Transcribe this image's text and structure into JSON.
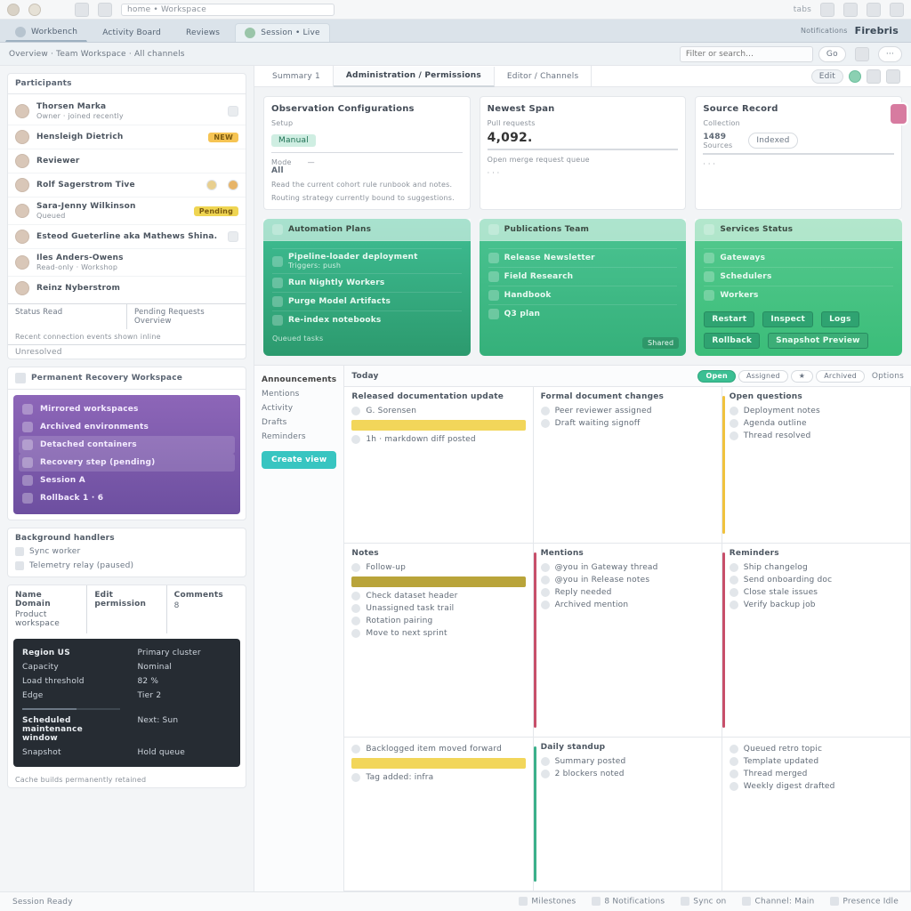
{
  "chrome": {
    "address": "home  •  Workspace",
    "label": "tabs"
  },
  "tabs": {
    "items": [
      {
        "label": "Workbench"
      },
      {
        "label": "Activity Board"
      },
      {
        "label": "Reviews"
      },
      {
        "label": "Session • Live"
      }
    ],
    "right_label": "Notifications",
    "brand": "Firebris"
  },
  "subbar": {
    "crumb": "Overview  ·  Team Workspace  ·  All channels",
    "search_placeholder": "Filter or search…",
    "search_action": "Go",
    "more": "···"
  },
  "mtabs": {
    "items": [
      "Summary 1",
      "Administration / Permissions",
      "Editor / Channels"
    ],
    "pill": "Edit"
  },
  "cards": [
    {
      "title": "Observation Configurations",
      "sub": "Setup",
      "chip": "Manual",
      "a_k": "Mode",
      "a_v": "All",
      "note": "Read the current cohort rule runbook and notes.",
      "hint": "Routing strategy currently bound to suggestions."
    },
    {
      "title": "Newest Span",
      "sub": "Pull requests",
      "big": "4,092.",
      "foot": "Open merge request queue"
    },
    {
      "title": "Source Record",
      "sub": "Collection",
      "a": "1489",
      "b": "Sources",
      "badge": "Indexed"
    }
  ],
  "greens": [
    {
      "head": "Automation Plans",
      "lines": [
        {
          "t": "Pipeline-loader deployment",
          "s": "Triggers: push"
        },
        {
          "t": "Run Nightly Workers",
          "s": ""
        },
        {
          "t": "Purge  Model Artifacts",
          "s": ""
        },
        {
          "t": "Re-index notebooks",
          "s": ""
        }
      ],
      "foot": "Queued tasks"
    },
    {
      "head": "Publications  Team",
      "lines": [
        {
          "t": "Release Newsletter",
          "s": ""
        },
        {
          "t": "Field Research",
          "s": ""
        },
        {
          "t": "Handbook",
          "s": ""
        },
        {
          "t": "Q3 plan",
          "s": ""
        }
      ],
      "tag": "Shared"
    },
    {
      "head": "Services  Status",
      "lines": [
        {
          "t": "Gateways",
          "s": ""
        },
        {
          "t": "Schedulers",
          "s": ""
        },
        {
          "t": "Workers",
          "s": ""
        }
      ],
      "btns": [
        "Restart",
        "Inspect",
        "Logs"
      ],
      "btn2": [
        "Rollback",
        "Snapshot  Preview"
      ]
    }
  ],
  "people": {
    "head": "Participants",
    "rows": [
      {
        "n": "Thorsen Marka",
        "s": "Owner · joined recently",
        "badge": ""
      },
      {
        "n": "Hensleigh Dietrich",
        "s": "",
        "badge": "NEW"
      },
      {
        "n": "Reviewer",
        "s": "",
        "badge": ""
      },
      {
        "n": "Rolf Sagerstrom Tive",
        "s": "",
        "badge": ""
      },
      {
        "n": "Sara-Jenny Wilkinson",
        "s": "Queued",
        "badge": "Pending"
      },
      {
        "n": "Esteod Gueterline aka Mathews Shina.",
        "s": "",
        "badge": ""
      },
      {
        "n": "Iles Anders-Owens",
        "s": "Read-only · Workshop",
        "badge": ""
      },
      {
        "n": "Reinz Nyberstrom",
        "s": "",
        "badge": ""
      }
    ],
    "cols": [
      "Status  Read",
      "Pending Requests Overview"
    ],
    "memo": "Recent connection events shown inline",
    "foot": "Unresolved"
  },
  "purple": {
    "head": "Permanent Recovery Workspace",
    "items": [
      "Mirrored workspaces",
      "Archived environments",
      "Detached containers",
      "Recovery step (pending)",
      "Session A",
      "Rollback 1 · 6"
    ]
  },
  "quiet": {
    "head": "Background handlers",
    "items": [
      "Sync worker",
      "Telemetry relay (paused)"
    ]
  },
  "table": {
    "cols": [
      {
        "h": "Name  Domain",
        "r": "Product workspace"
      },
      {
        "h": "Edit permission",
        "r": ""
      },
      {
        "h": "Comments",
        "r": "8"
      }
    ]
  },
  "dark": {
    "rows": [
      [
        "Region US",
        "Primary cluster"
      ],
      [
        "Capacity",
        "Nominal"
      ],
      [
        "Load threshold",
        "82 %"
      ],
      [
        "Edge",
        "Tier 2"
      ],
      [
        "Scheduled maintenance window",
        "Next: Sun"
      ],
      [
        "Snapshot",
        "Hold queue"
      ]
    ]
  },
  "side_footer": "Cache builds permanently retained",
  "lower": {
    "nav": [
      "Announcements",
      "Mentions",
      "Activity",
      "Drafts",
      "Reminders"
    ],
    "nav_btn": "Create view",
    "headrow": {
      "a": "Today",
      "chips": [
        "Open",
        "Assigned",
        "★",
        "Archived"
      ],
      "right": "Options"
    },
    "cells": [
      {
        "t": "Released documentation update",
        "lines": [
          "G. Sorensen",
          "1h · markdown diff posted"
        ]
      },
      {
        "t": "Formal document changes",
        "lines": [
          "Peer reviewer assigned",
          "Draft waiting signoff"
        ]
      },
      {
        "t": "Open questions",
        "lines": [
          "Deployment notes",
          "Agenda outline",
          "Thread resolved"
        ],
        "stripe": "sY"
      },
      {
        "t": "Notes",
        "lines": [
          "Follow-up",
          "Check dataset header",
          "Unassigned task trail",
          "Rotation pairing",
          "Move to next sprint"
        ]
      },
      {
        "t": "Mentions",
        "lines": [
          "@you in Gateway thread",
          "@you in Release notes",
          "Reply needed",
          "Archived mention"
        ],
        "stripe": "sR"
      },
      {
        "t": "Reminders",
        "lines": [
          "Ship changelog",
          "Send onboarding doc",
          "Close stale issues",
          "Verify backup job"
        ],
        "stripe": "sR"
      },
      {
        "t": "",
        "lines": [
          "Backlogged item moved forward",
          "Tag added: infra"
        ]
      },
      {
        "t": "Daily standup",
        "lines": [
          "Summary posted",
          "2 blockers noted"
        ],
        "stripe": "sG"
      },
      {
        "t": "",
        "lines": [
          "Queued retro topic",
          "Template updated",
          "Thread merged",
          "Weekly digest drafted"
        ]
      }
    ]
  },
  "footer": {
    "left": "Session Ready",
    "items": [
      "Milestones",
      "8 Notifications",
      "Sync on",
      "Channel: Main",
      "Presence  Idle"
    ]
  }
}
